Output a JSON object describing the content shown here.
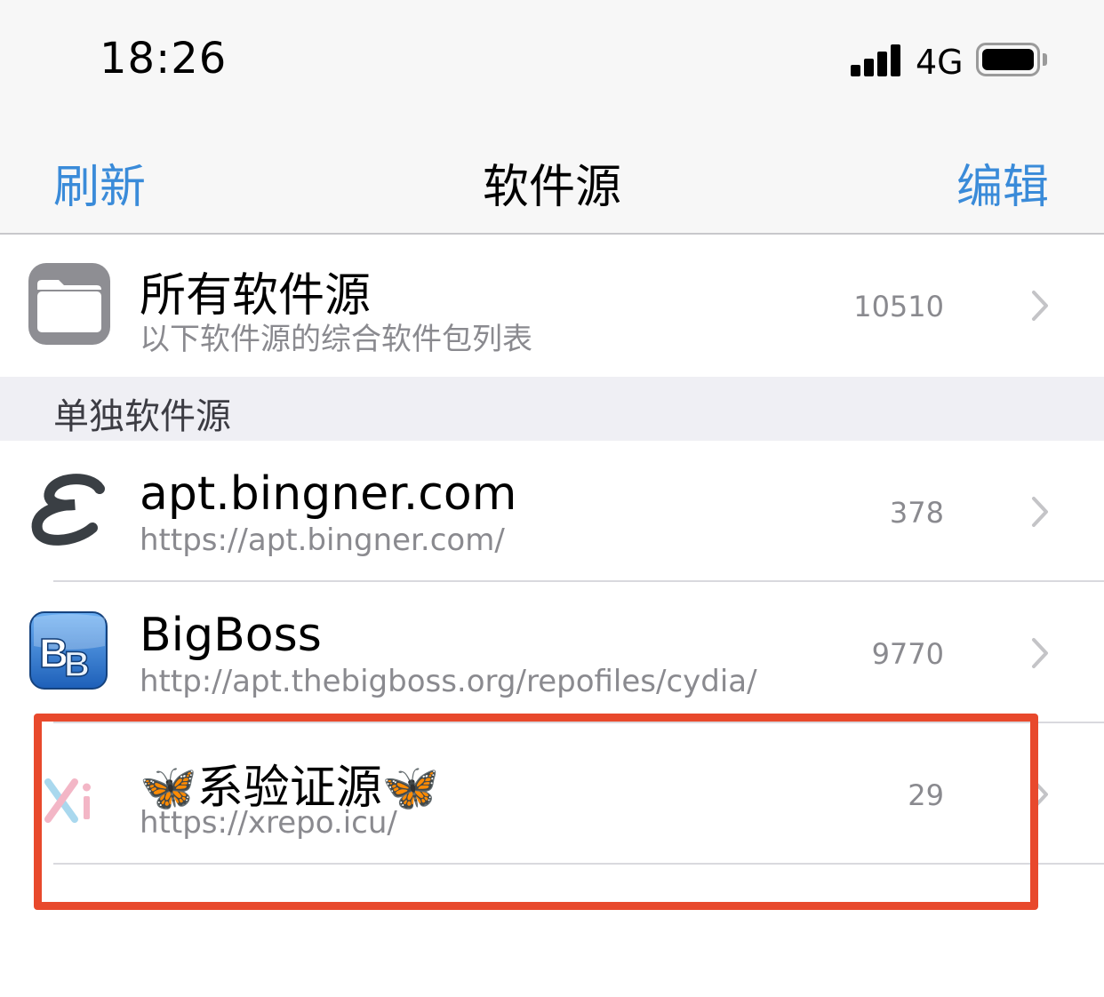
{
  "status_bar": {
    "time": "18:26",
    "network": "4G",
    "battery_level": 1.0
  },
  "nav": {
    "left_label": "刷新",
    "title": "软件源",
    "right_label": "编辑"
  },
  "all_sources": {
    "title": "所有软件源",
    "subtitle": "以下软件源的综合软件包列表",
    "count": "10510"
  },
  "section": {
    "label": "单独软件源"
  },
  "sources": [
    {
      "name": "apt.bingner.com",
      "url": "https://apt.bingner.com/",
      "count": "378",
      "icon": "elucubratus-e-icon"
    },
    {
      "name": "BigBoss",
      "url": "http://apt.thebigboss.org/repofiles/cydia/",
      "count": "9770",
      "icon": "bigboss-icon"
    },
    {
      "name": "🦋系验证源🦋",
      "url": "https://xrepo.icu/",
      "count": "29",
      "icon": "xi-logo-icon"
    }
  ],
  "colors": {
    "accent": "#3a8bd9",
    "highlight": "#e8492c",
    "secondary_text": "#8a8a8f",
    "section_background": "#efeff4"
  }
}
